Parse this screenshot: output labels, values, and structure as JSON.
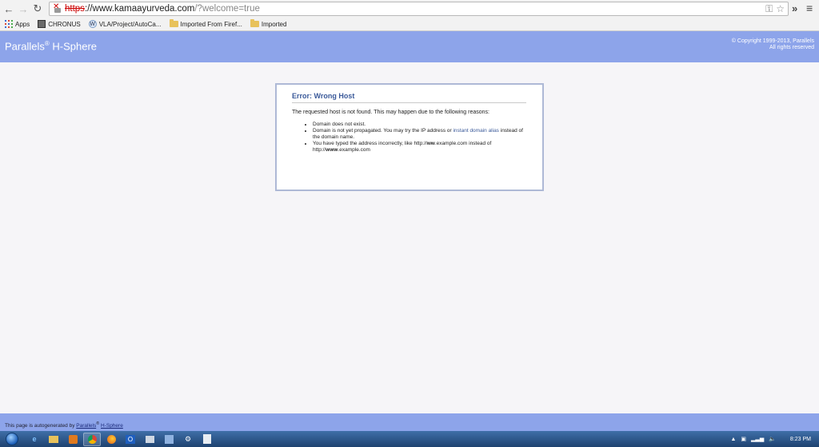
{
  "browser": {
    "url_scheme": "https",
    "url_host": "://www.kamaayurveda.com",
    "url_path": "/?welcome=true",
    "bookmarks": [
      {
        "label": "Apps",
        "icon": "apps-icon"
      },
      {
        "label": "CHRONUS",
        "icon": "image-icon"
      },
      {
        "label": "VLA/Project/AutoCa...",
        "icon": "w-icon"
      },
      {
        "label": "Imported From Firef...",
        "icon": "folder-icon"
      },
      {
        "label": "Imported",
        "icon": "folder-icon"
      }
    ]
  },
  "header": {
    "brand": "Parallels",
    "brand_mark": "®",
    "brand_suffix": " H-Sphere",
    "copyright_line1": "© Copyright 1999-2013, Parallels",
    "copyright_line2": "All rights reserved"
  },
  "error": {
    "title": "Error: Wrong Host",
    "intro": "The requested host is not found. This may happen due to the following reasons:",
    "reason1": "Domain does not exist.",
    "reason2_pre": "Domain is not yet propagated. You may try the IP address or ",
    "reason2_link": "instant domain alias",
    "reason2_post": " instead of the domain name.",
    "reason3_a": "You have typed the address incorrectly, like http://",
    "reason3_b": "ww",
    "reason3_c": ".example.com instead of http://",
    "reason3_d": "www",
    "reason3_e": ".example.com"
  },
  "footer": {
    "text": "This page is autogenerated by ",
    "link1": "Parallels",
    "mark": "®",
    "link2": "H-Sphere"
  },
  "taskbar": {
    "time": "8:23 PM"
  }
}
